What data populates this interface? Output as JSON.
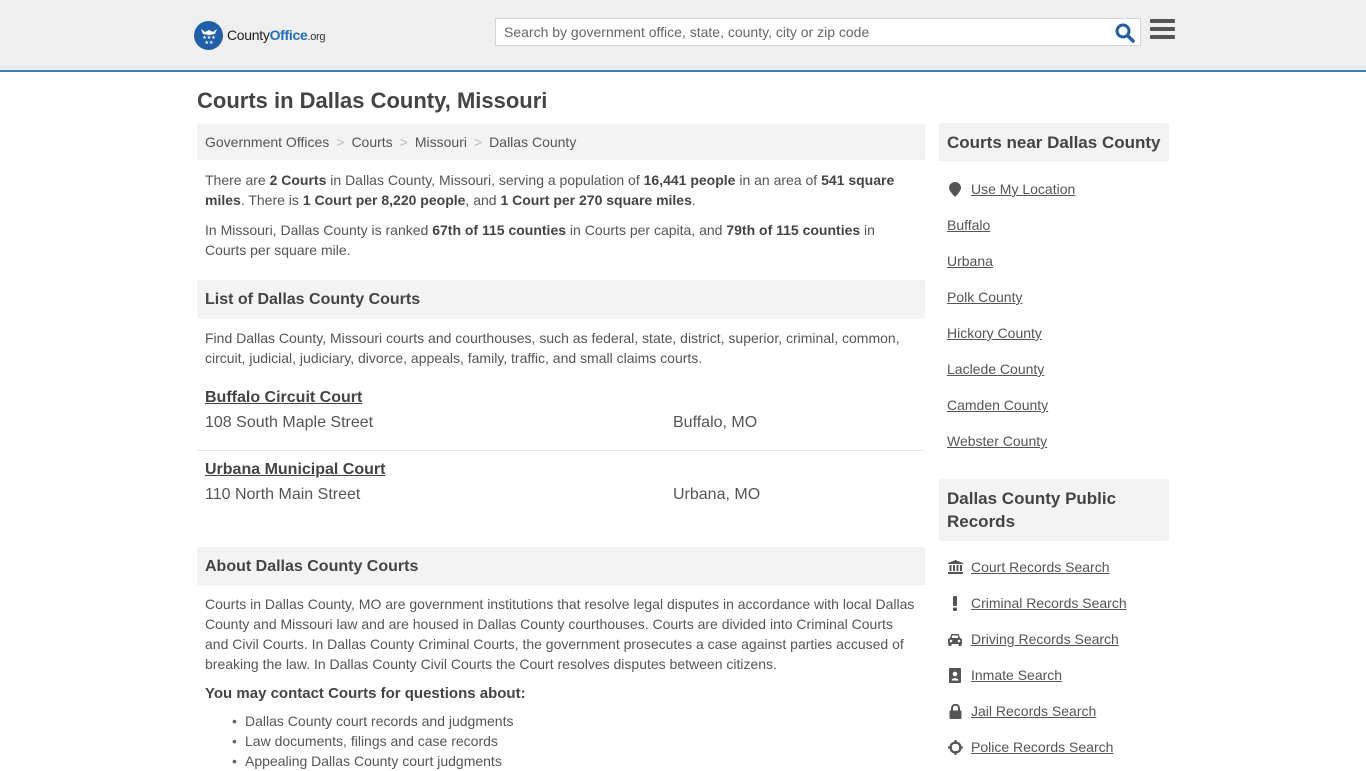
{
  "header": {
    "logo": {
      "part1": "County",
      "part2": "Office",
      "part3": ".org"
    },
    "search_placeholder": "Search by government office, state, county, city or zip code",
    "search_value": "",
    "colors": {
      "brand_blue": "#1f5fa8",
      "accent_bar": "#3a7fb3"
    }
  },
  "page": {
    "title": "Courts in Dallas County, Missouri",
    "breadcrumb": [
      "Government Offices",
      "Courts",
      "Missouri",
      "Dallas County"
    ],
    "intro": {
      "p1": [
        {
          "t": "There are ",
          "b": false
        },
        {
          "t": "2 Courts",
          "b": true
        },
        {
          "t": " in Dallas County, Missouri, serving a population of ",
          "b": false
        },
        {
          "t": "16,441 people",
          "b": true
        },
        {
          "t": " in an area of ",
          "b": false
        },
        {
          "t": "541 square miles",
          "b": true
        },
        {
          "t": ". There is ",
          "b": false
        },
        {
          "t": "1 Court per 8,220 people",
          "b": true
        },
        {
          "t": ", and ",
          "b": false
        },
        {
          "t": "1 Court per 270 square miles",
          "b": true
        },
        {
          "t": ".",
          "b": false
        }
      ],
      "p2": [
        {
          "t": "In Missouri, Dallas County is ranked ",
          "b": false
        },
        {
          "t": "67th of 115 counties",
          "b": true
        },
        {
          "t": " in Courts per capita, and ",
          "b": false
        },
        {
          "t": "79th of 115 counties",
          "b": true
        },
        {
          "t": " in Courts per square mile.",
          "b": false
        }
      ]
    },
    "list_section": {
      "heading": "List of Dallas County Courts",
      "description": "Find Dallas County, Missouri courts and courthouses, such as federal, state, district, superior, criminal, common, circuit, judicial, judiciary, divorce, appeals, family, traffic, and small claims courts.",
      "courts": [
        {
          "name": "Buffalo Circuit Court",
          "address": "108 South Maple Street",
          "city": "Buffalo, MO"
        },
        {
          "name": "Urbana Municipal Court",
          "address": "110 North Main Street",
          "city": "Urbana, MO"
        }
      ]
    },
    "about_section": {
      "heading": "About Dallas County Courts",
      "text": "Courts in Dallas County, MO are government institutions that resolve legal disputes in accordance with local Dallas County and Missouri law and are housed in Dallas County courthouses. Courts are divided into Criminal Courts and Civil Courts. In Dallas County Criminal Courts, the government prosecutes a case against parties accused of breaking the law. In Dallas County Civil Courts the Court resolves disputes between citizens.",
      "contact_heading": "You may contact Courts for questions about:",
      "bullets": [
        "Dallas County court records and judgments",
        "Law documents, filings and case records",
        "Appealing Dallas County court judgments"
      ]
    }
  },
  "sidebar": {
    "near": {
      "heading": "Courts near Dallas County",
      "use_location": {
        "label": "Use My Location",
        "icon": "map-marker-icon"
      },
      "links": [
        "Buffalo",
        "Urbana",
        "Polk County",
        "Hickory County",
        "Laclede County",
        "Camden County",
        "Webster County"
      ]
    },
    "public_records": {
      "heading": "Dallas County Public Records",
      "links": [
        {
          "label": "Court Records Search",
          "icon": "courthouse-icon"
        },
        {
          "label": "Criminal Records Search",
          "icon": "exclamation-icon"
        },
        {
          "label": "Driving Records Search",
          "icon": "car-icon"
        },
        {
          "label": "Inmate Search",
          "icon": "id-badge-icon"
        },
        {
          "label": "Jail Records Search",
          "icon": "lock-icon"
        },
        {
          "label": "Police Records Search",
          "icon": "crosshairs-icon"
        }
      ]
    }
  }
}
